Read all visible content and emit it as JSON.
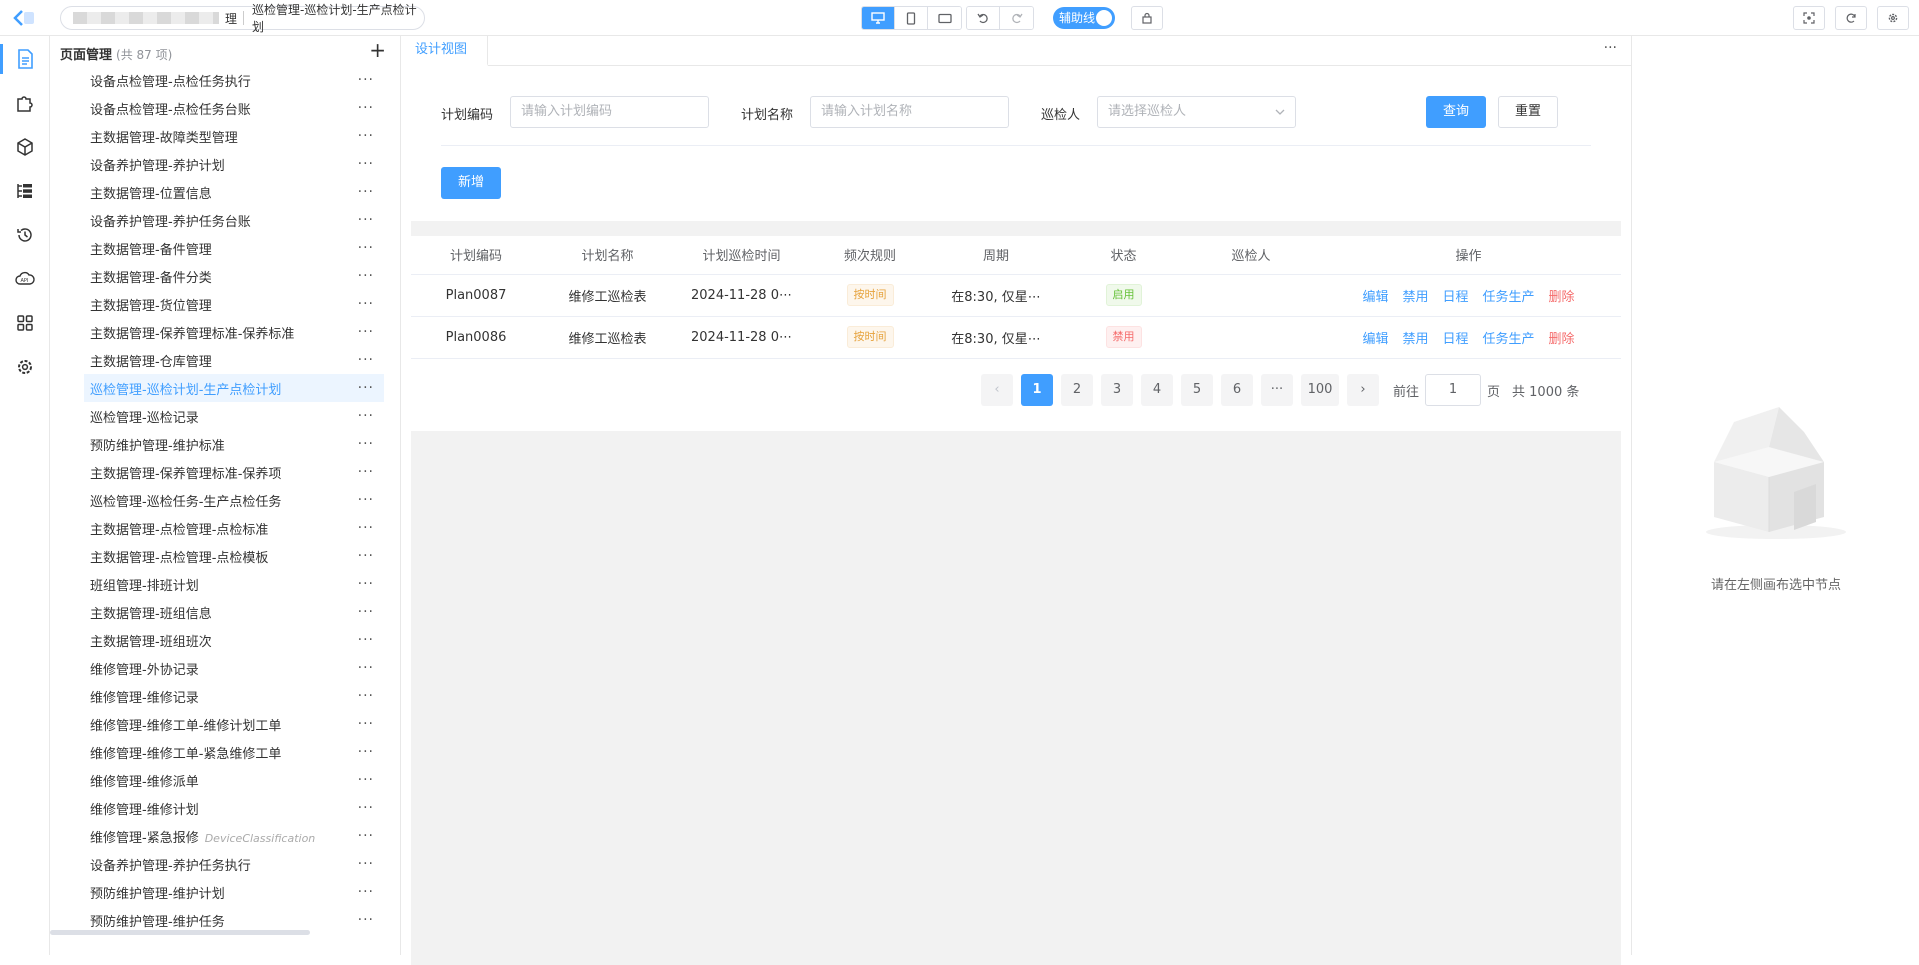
{
  "topbar": {
    "breadcrumb_suffix": "理",
    "page_title": "巡检管理-巡检计划-生产点检计划",
    "aux_label": "辅助线"
  },
  "panel": {
    "title": "页面管理",
    "count": "(共 87 项)",
    "items": [
      {
        "label": "设备点检管理-点检任务执行",
        "en": ""
      },
      {
        "label": "设备点检管理-点检任务台账",
        "en": ""
      },
      {
        "label": "主数据管理-故障类型管理",
        "en": ""
      },
      {
        "label": "设备养护管理-养护计划",
        "en": ""
      },
      {
        "label": "主数据管理-位置信息",
        "en": ""
      },
      {
        "label": "设备养护管理-养护任务台账",
        "en": ""
      },
      {
        "label": "主数据管理-备件管理",
        "en": ""
      },
      {
        "label": "主数据管理-备件分类",
        "en": ""
      },
      {
        "label": "主数据管理-货位管理",
        "en": ""
      },
      {
        "label": "主数据管理-保养管理标准-保养标准",
        "en": ""
      },
      {
        "label": "主数据管理-仓库管理",
        "en": ""
      },
      {
        "label": "巡检管理-巡检计划-生产点检计划",
        "en": "",
        "selected": true
      },
      {
        "label": "巡检管理-巡检记录",
        "en": ""
      },
      {
        "label": "预防维护管理-维护标准",
        "en": ""
      },
      {
        "label": "主数据管理-保养管理标准-保养项",
        "en": ""
      },
      {
        "label": "巡检管理-巡检任务-生产点检任务",
        "en": ""
      },
      {
        "label": "主数据管理-点检管理-点检标准",
        "en": ""
      },
      {
        "label": "主数据管理-点检管理-点检模板",
        "en": ""
      },
      {
        "label": "班组管理-排班计划",
        "en": ""
      },
      {
        "label": "主数据管理-班组信息",
        "en": ""
      },
      {
        "label": "主数据管理-班组班次",
        "en": ""
      },
      {
        "label": "维修管理-外协记录",
        "en": ""
      },
      {
        "label": "维修管理-维修记录",
        "en": ""
      },
      {
        "label": "维修管理-维修工单-维修计划工单",
        "en": ""
      },
      {
        "label": "维修管理-维修工单-紧急维修工单",
        "en": ""
      },
      {
        "label": "维修管理-维修派单",
        "en": ""
      },
      {
        "label": "维修管理-维修计划",
        "en": ""
      },
      {
        "label": "维修管理-紧急报修",
        "en": "DeviceClassification"
      },
      {
        "label": "设备养护管理-养护任务执行",
        "en": ""
      },
      {
        "label": "预防维护管理-维护计划",
        "en": ""
      },
      {
        "label": "预防维护管理-维护任务",
        "en": ""
      }
    ]
  },
  "design": {
    "tab_label": "设计视图",
    "form": {
      "code_label": "计划编码",
      "code_placeholder": "请输入计划编码",
      "name_label": "计划名称",
      "name_placeholder": "请输入计划名称",
      "inspector_label": "巡检人",
      "inspector_placeholder": "请选择巡检人",
      "query_label": "查询",
      "reset_label": "重置",
      "add_label": "新增"
    },
    "table": {
      "headers": [
        "计划编码",
        "计划名称",
        "计划巡检时间",
        "频次规则",
        "周期",
        "状态",
        "巡检人",
        "操作"
      ],
      "rows": [
        {
          "code": "Plan0087",
          "name": "维修工巡检表",
          "time": "2024-11-28 0⋯",
          "rule": "按时间",
          "cycle": "在8:30, 仅星⋯",
          "status": "启用",
          "status_kind": "ok",
          "inspector": ""
        },
        {
          "code": "Plan0086",
          "name": "维修工巡检表",
          "time": "2024-11-28 0⋯",
          "rule": "按时间",
          "cycle": "在8:30, 仅星⋯",
          "status": "禁用",
          "status_kind": "danger",
          "inspector": ""
        }
      ],
      "actions": [
        "编辑",
        "禁用",
        "日程",
        "任务生产",
        "删除"
      ]
    },
    "pagination": {
      "pages": [
        "1",
        "2",
        "3",
        "4",
        "5",
        "6"
      ],
      "current": "1",
      "ellipsis": "···",
      "last": "100",
      "goto_label": "前往",
      "goto_value": "1",
      "page_unit": "页",
      "total": "共 1000 条"
    }
  },
  "props": {
    "empty_text": "请在左侧画布选中节点"
  },
  "colors": {
    "primary": "#409eff",
    "danger": "#f56c6c",
    "success": "#67c23a",
    "warning": "#e6a23c"
  }
}
